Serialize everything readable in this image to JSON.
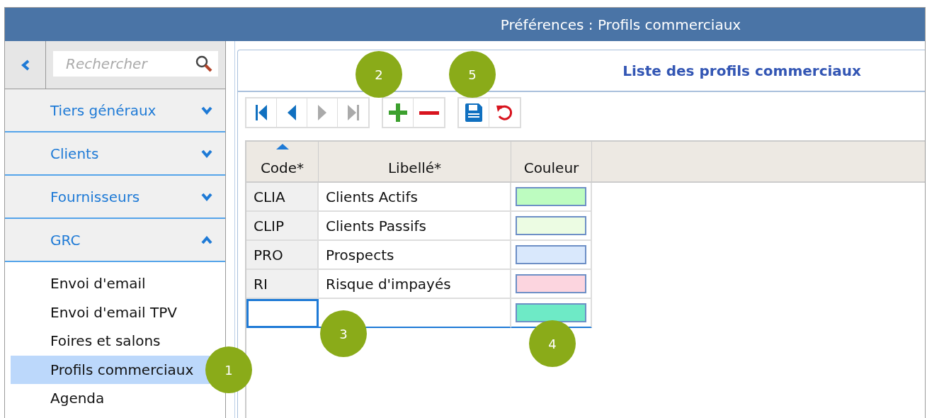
{
  "window": {
    "title": "Préférences : Profils commerciaux"
  },
  "sidebar": {
    "search": {
      "placeholder": "Rechercher"
    },
    "sections": [
      {
        "label": "Tiers généraux",
        "expanded": false
      },
      {
        "label": "Clients",
        "expanded": false
      },
      {
        "label": "Fournisseurs",
        "expanded": false
      },
      {
        "label": "GRC",
        "expanded": true,
        "items": [
          {
            "label": "Envoi d'email",
            "selected": false
          },
          {
            "label": "Envoi d'email TPV",
            "selected": false
          },
          {
            "label": "Foires et salons",
            "selected": false
          },
          {
            "label": "Profils commerciaux",
            "selected": true
          },
          {
            "label": "Agenda",
            "selected": false
          }
        ]
      }
    ]
  },
  "panel": {
    "title": "Liste des profils commerciaux",
    "toolbar": [
      [
        {
          "kind": "first",
          "disabled": false
        },
        {
          "kind": "prev",
          "disabled": false
        },
        {
          "kind": "next",
          "disabled": true
        },
        {
          "kind": "last",
          "disabled": true
        }
      ],
      [
        {
          "kind": "add",
          "disabled": false
        },
        {
          "kind": "remove",
          "disabled": false
        }
      ],
      [
        {
          "kind": "save",
          "disabled": false
        },
        {
          "kind": "undo",
          "disabled": false
        }
      ]
    ],
    "table": {
      "columns": [
        {
          "label": "Code*",
          "sorted": true
        },
        {
          "label": "Libellé*",
          "sorted": false
        },
        {
          "label": "Couleur",
          "sorted": false
        }
      ],
      "rows": [
        {
          "code": "CLIA",
          "label": "Clients Actifs",
          "color": "#bdfcc0",
          "editing": false
        },
        {
          "code": "CLIP",
          "label": "Clients Passifs",
          "color": "#ecfce3",
          "editing": false
        },
        {
          "code": "PRO",
          "label": "Prospects",
          "color": "#d9e8fc",
          "editing": false
        },
        {
          "code": "RI",
          "label": "Risque d'impayés",
          "color": "#fcd5df",
          "editing": false
        },
        {
          "code": "",
          "label": "",
          "color": "#6eeac6",
          "editing": true
        }
      ]
    }
  },
  "callouts": [
    "1",
    "2",
    "3",
    "4",
    "5"
  ]
}
